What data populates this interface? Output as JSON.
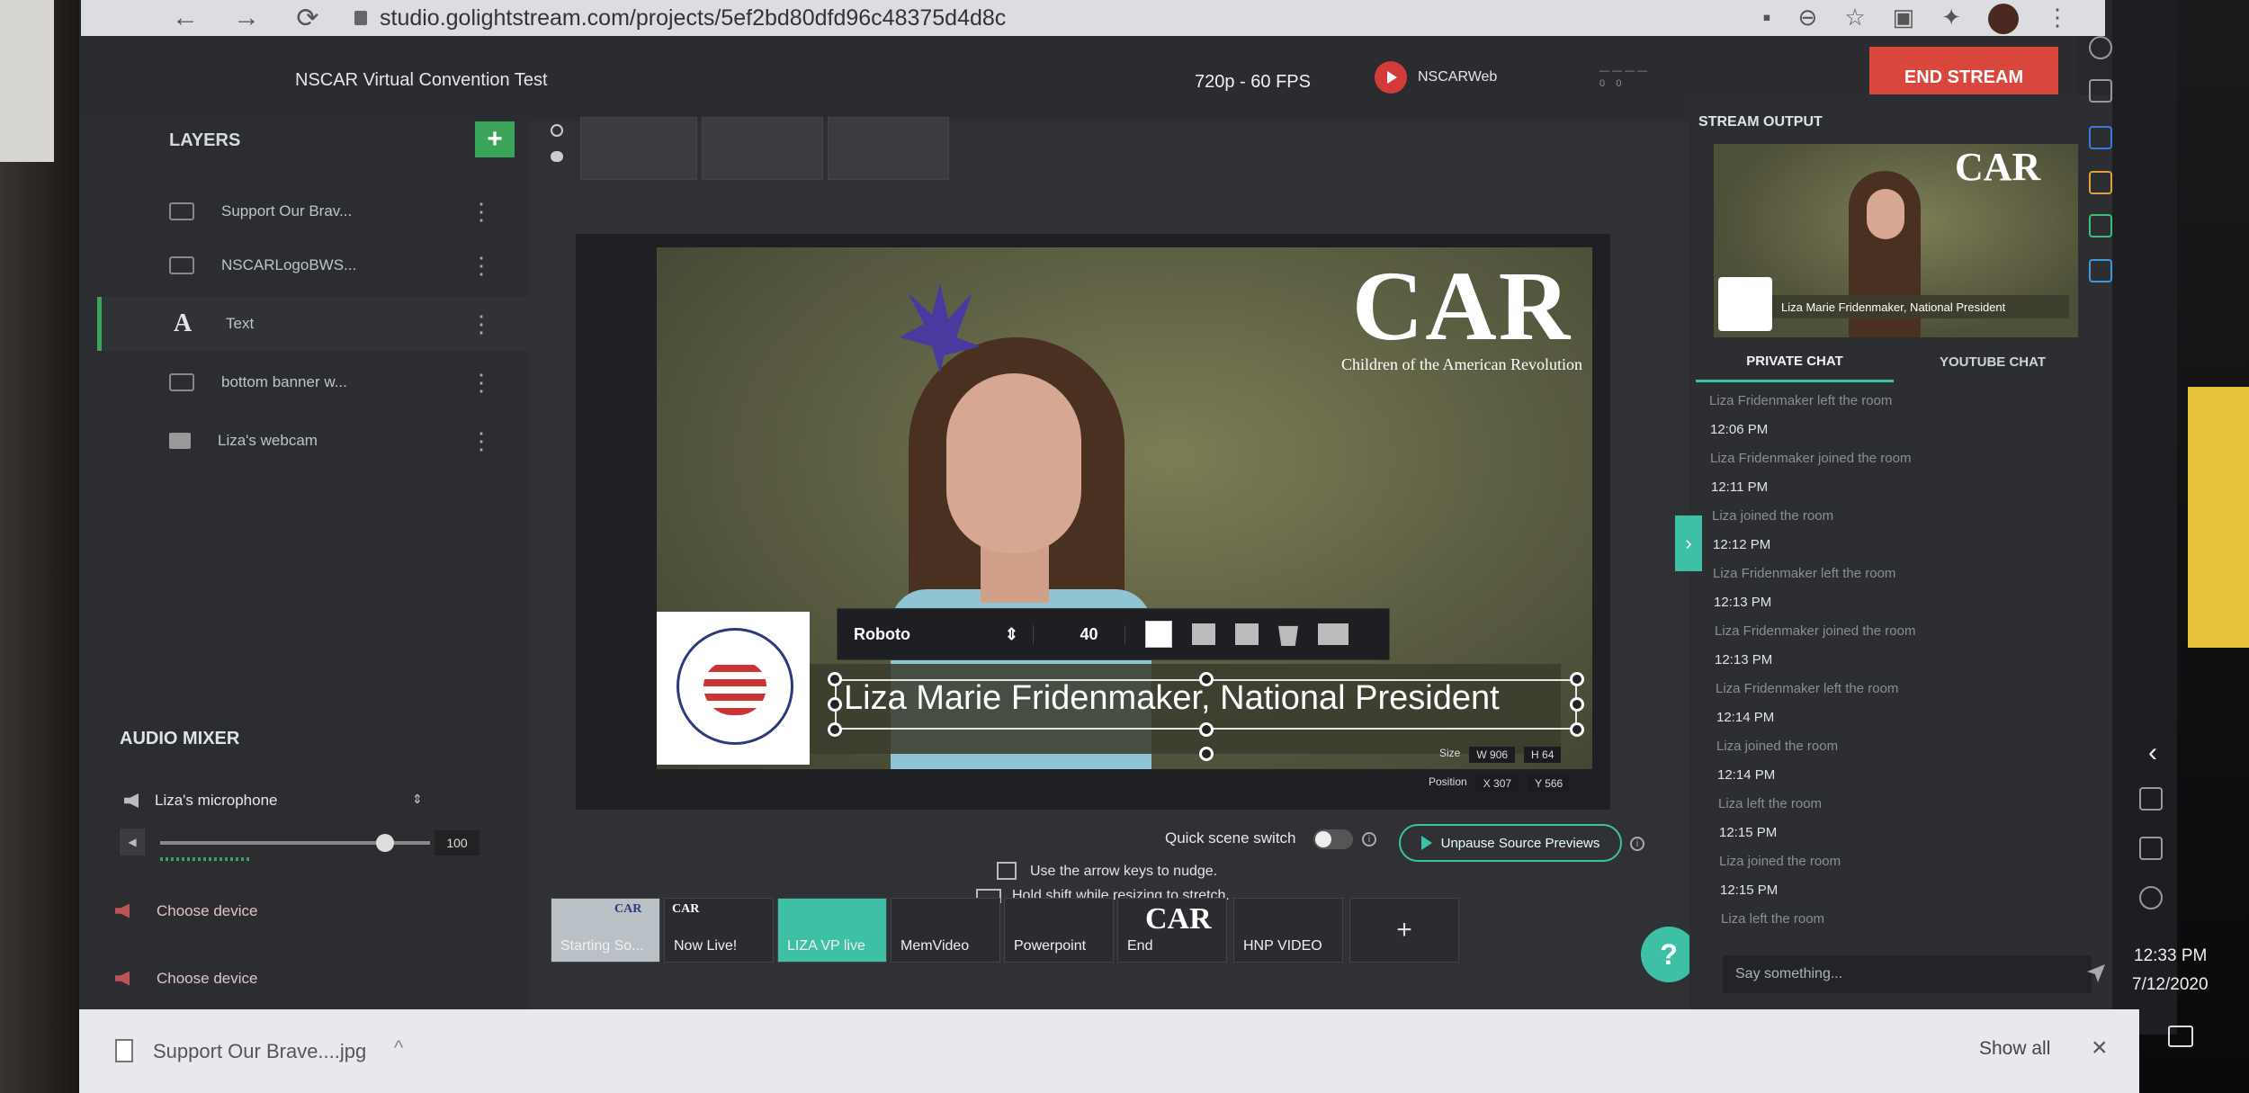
{
  "browser": {
    "url": "studio.golightstream.com/projects/5ef2bd80dfd96c48375d4d8c"
  },
  "header": {
    "project_title": "NSCAR Virtual Convention Test",
    "resolution": "720p - 60 FPS",
    "channel_name": "NSCARWeb",
    "end_stream_label": "END STREAM"
  },
  "layers": {
    "title": "LAYERS",
    "add_label": "+",
    "items": [
      {
        "label": "Support Our Brav...",
        "icon": "image-icon"
      },
      {
        "label": "NSCARLogoBWS...",
        "icon": "image-icon"
      },
      {
        "label": "Text",
        "icon": "text-icon"
      },
      {
        "label": "bottom banner w...",
        "icon": "image-icon"
      },
      {
        "label": "Liza's webcam",
        "icon": "webcam-icon"
      }
    ]
  },
  "audio_mixer": {
    "title": "AUDIO MIXER",
    "mic_name": "Liza's microphone",
    "volume": 100,
    "devices": [
      "Choose device",
      "Choose device"
    ]
  },
  "stage": {
    "logo_letters": "CAR",
    "logo_subtitle": "Children of the American Revolution",
    "lower_third_text": "Liza Marie Fridenmaker, National President",
    "toolbar": {
      "font": "Roboto",
      "font_size": "40",
      "text_color": "#ffffff"
    },
    "size_label": "Size",
    "size_w": "906",
    "size_h": "64",
    "position_label": "Position",
    "pos_x": "307",
    "pos_y": "566",
    "quick_scene_label": "Quick scene switch",
    "unpause_label": "Unpause Source Previews",
    "hint_nudge": "Use the arrow keys to nudge.",
    "hint_shift": "Hold shift while resizing to stretch."
  },
  "scenes": [
    {
      "label": "Starting So...",
      "active": false
    },
    {
      "label": "Now Live!",
      "active": false
    },
    {
      "label": "LIZA VP live",
      "active": true
    },
    {
      "label": "MemVideo",
      "active": false
    },
    {
      "label": "Powerpoint",
      "active": false
    },
    {
      "label": "End",
      "active": false
    },
    {
      "label": "HNP VIDEO",
      "active": false
    }
  ],
  "stream_output": {
    "label": "STREAM OUTPUT",
    "banner_text": "Liza Marie Fridenmaker, National President",
    "logo": "CAR"
  },
  "chat": {
    "tabs": [
      "PRIVATE CHAT",
      "YOUTUBE CHAT"
    ],
    "lines": [
      {
        "type": "msg",
        "text": "Liza Fridenmaker left the room"
      },
      {
        "type": "time",
        "text": "12:06 PM"
      },
      {
        "type": "msg",
        "text": "Liza Fridenmaker joined the room"
      },
      {
        "type": "time",
        "text": "12:11 PM"
      },
      {
        "type": "msg",
        "text": "Liza joined the room"
      },
      {
        "type": "time",
        "text": "12:12 PM"
      },
      {
        "type": "msg",
        "text": "Liza Fridenmaker left the room"
      },
      {
        "type": "time",
        "text": "12:13 PM"
      },
      {
        "type": "msg",
        "text": "Liza Fridenmaker joined the room"
      },
      {
        "type": "time",
        "text": "12:13 PM"
      },
      {
        "type": "msg",
        "text": "Liza Fridenmaker left the room"
      },
      {
        "type": "time",
        "text": "12:14 PM"
      },
      {
        "type": "msg",
        "text": "Liza joined the room"
      },
      {
        "type": "time",
        "text": "12:14 PM"
      },
      {
        "type": "msg",
        "text": "Liza left the room"
      },
      {
        "type": "time",
        "text": "12:15 PM"
      },
      {
        "type": "msg",
        "text": "Liza joined the room"
      },
      {
        "type": "time",
        "text": "12:15 PM"
      },
      {
        "type": "msg",
        "text": "Liza left the room"
      }
    ],
    "placeholder": "Say something..."
  },
  "system": {
    "time": "12:33 PM",
    "date": "7/12/2020"
  },
  "download": {
    "filename": "Support Our Brave....jpg",
    "show_all": "Show all"
  },
  "colors": {
    "accent": "#3ec0a6",
    "end_stream": "#d9473c",
    "add_layer": "#3aa45a"
  }
}
